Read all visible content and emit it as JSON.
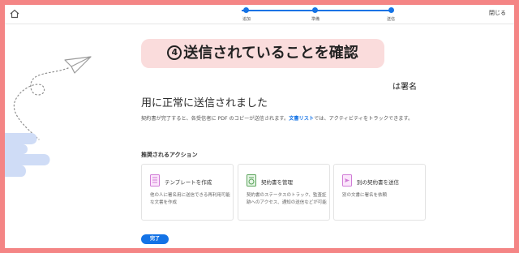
{
  "topbar": {
    "close_label": "閉じる",
    "steps": [
      {
        "label": "追加"
      },
      {
        "label": "準備"
      },
      {
        "label": "送信"
      }
    ]
  },
  "banner": {
    "number": "4",
    "text": "送信されていることを確認"
  },
  "main": {
    "seal_text": "は署名",
    "title": "用に正常に送信されました",
    "description_prefix": "契約書が完了すると、各受信者に PDF のコピーが送信されます。",
    "description_link": "文書リスト",
    "description_suffix": "では、アクティビティをトラックできます。",
    "section_title": "推奨されるアクション",
    "cards": [
      {
        "title": "テンプレートを作成",
        "description": "他の人に署名用に送信できる再利用可能な文書を作成",
        "icon": "template-icon"
      },
      {
        "title": "契約書を管理",
        "description": "契約書のステータスのトラック、監査証跡へのアクセス、通知の送信などが可能",
        "icon": "manage-agreement-icon"
      },
      {
        "title": "別の契約書を送信",
        "description": "別の文書に署名を依頼",
        "icon": "send-another-icon"
      }
    ],
    "done_label": "完了"
  },
  "colors": {
    "accent": "#1473e6",
    "outer_border": "#f48585",
    "banner_bg": "#fadcdc",
    "decor_blue": "#cfdcf6",
    "card_icon": "#d07bd6"
  }
}
